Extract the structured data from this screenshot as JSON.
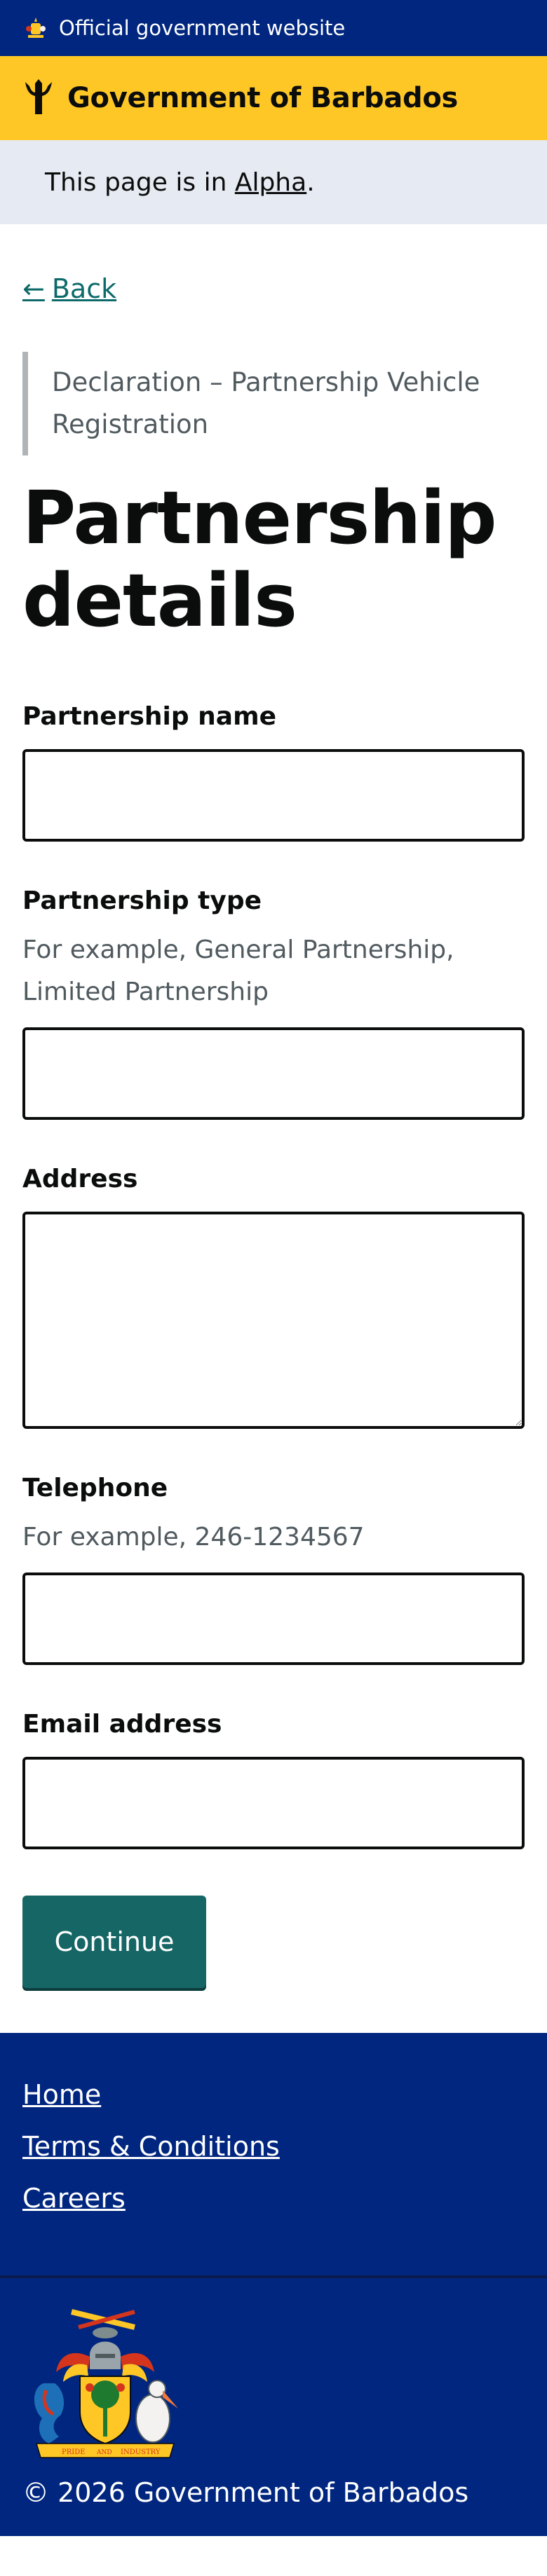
{
  "banner": {
    "text": "Official government website",
    "icon": "crest-icon"
  },
  "header": {
    "title": "Government of Barbados",
    "icon": "trident-icon"
  },
  "phase": {
    "prefix": "This page is in ",
    "link": "Alpha",
    "suffix": "."
  },
  "back": {
    "arrow": "←",
    "label": "Back"
  },
  "caption": "Declaration – Partnership Vehicle Registration",
  "title": "Partnership details",
  "fields": {
    "name": {
      "label": "Partnership name",
      "value": ""
    },
    "type": {
      "label": "Partnership type",
      "hint": "For example, General Partnership, Limited Partnership",
      "value": ""
    },
    "address": {
      "label": "Address",
      "value": ""
    },
    "telephone": {
      "label": "Telephone",
      "hint": "For example, 246-1234567",
      "value": ""
    },
    "email": {
      "label": "Email address",
      "value": ""
    }
  },
  "continue_label": "Continue",
  "footer": {
    "links": [
      "Home",
      "Terms & Conditions",
      "Careers"
    ],
    "copyright": "© 2026 Government of Barbados",
    "arms_motto_left": "PRIDE",
    "arms_motto_mid": "AND",
    "arms_motto_right": "INDUSTRY"
  },
  "colors": {
    "banner_blue": "#00267f",
    "header_gold": "#ffc726",
    "phase_bg": "#e6eaf2",
    "button_teal": "#166666",
    "link_teal": "#0e6a6a"
  }
}
